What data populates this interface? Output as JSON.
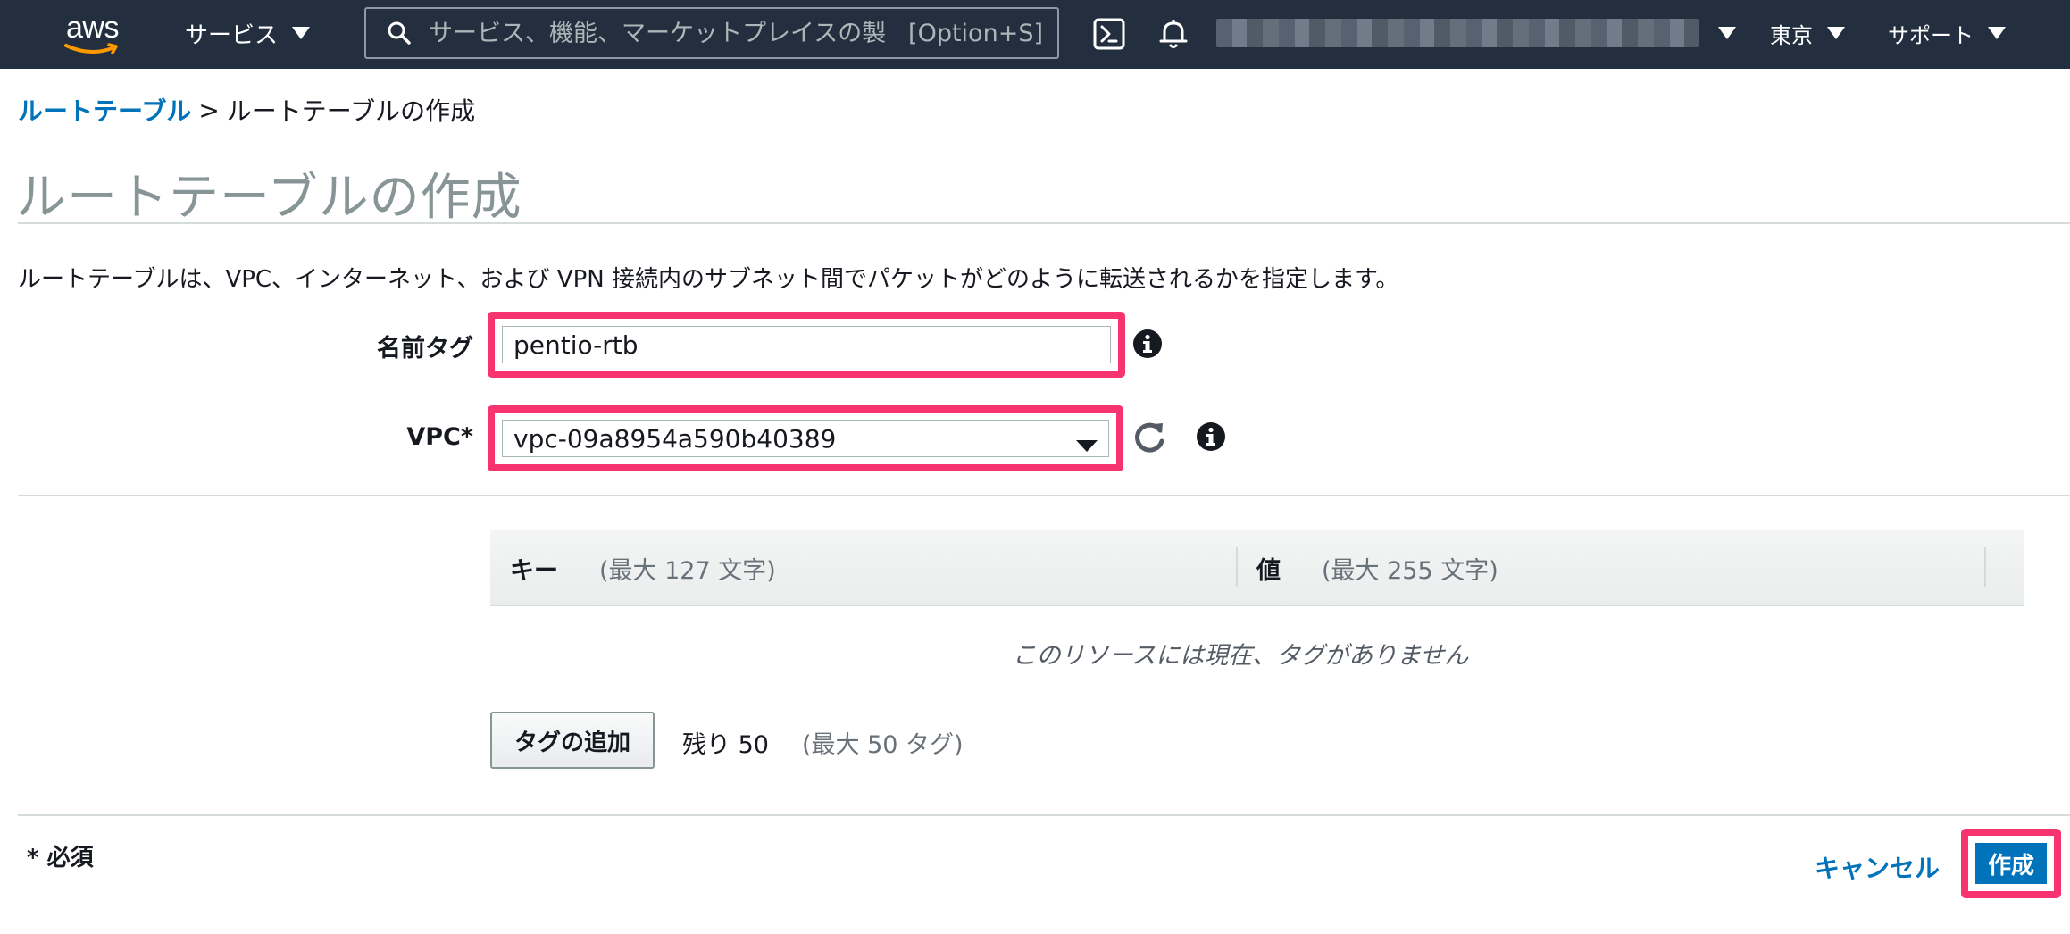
{
  "nav": {
    "services_label": "サービス",
    "search_placeholder": "サービス、機能、マーケットプレイスの製",
    "search_shortcut": "[Option+S]",
    "region_label": "東京",
    "support_label": "サポート",
    "icons": [
      "aws-logo",
      "search-icon",
      "cloudshell-icon",
      "bell-icon",
      "caret-down-icon"
    ],
    "colors": {
      "nav_bg": "#232f3e",
      "accent_orange": "#ff9900"
    }
  },
  "breadcrumb": {
    "parent": "ルートテーブル",
    "separator": ">",
    "current": "ルートテーブルの作成"
  },
  "page": {
    "title": "ルートテーブルの作成",
    "description": "ルートテーブルは、VPC、インターネット、および VPN 接続内のサブネット間でパケットがどのように転送されるかを指定します。"
  },
  "form": {
    "name_tag": {
      "label": "名前タグ",
      "value": "pentio-rtb"
    },
    "vpc": {
      "label": "VPC*",
      "value": "vpc-09a8954a590b40389"
    },
    "highlight_color": "#f7346f"
  },
  "tags": {
    "key_header": "キー",
    "key_hint": "(最大 127 文字)",
    "value_header": "値",
    "value_hint": "(最大 255 文字)",
    "empty_message": "このリソースには現在、タグがありません",
    "add_button": "タグの追加",
    "remaining": "残り 50",
    "max": "(最大 50 タグ)"
  },
  "footer": {
    "required_note": "* 必須",
    "cancel_label": "キャンセル",
    "create_label": "作成",
    "primary_color": "#0073bb"
  }
}
